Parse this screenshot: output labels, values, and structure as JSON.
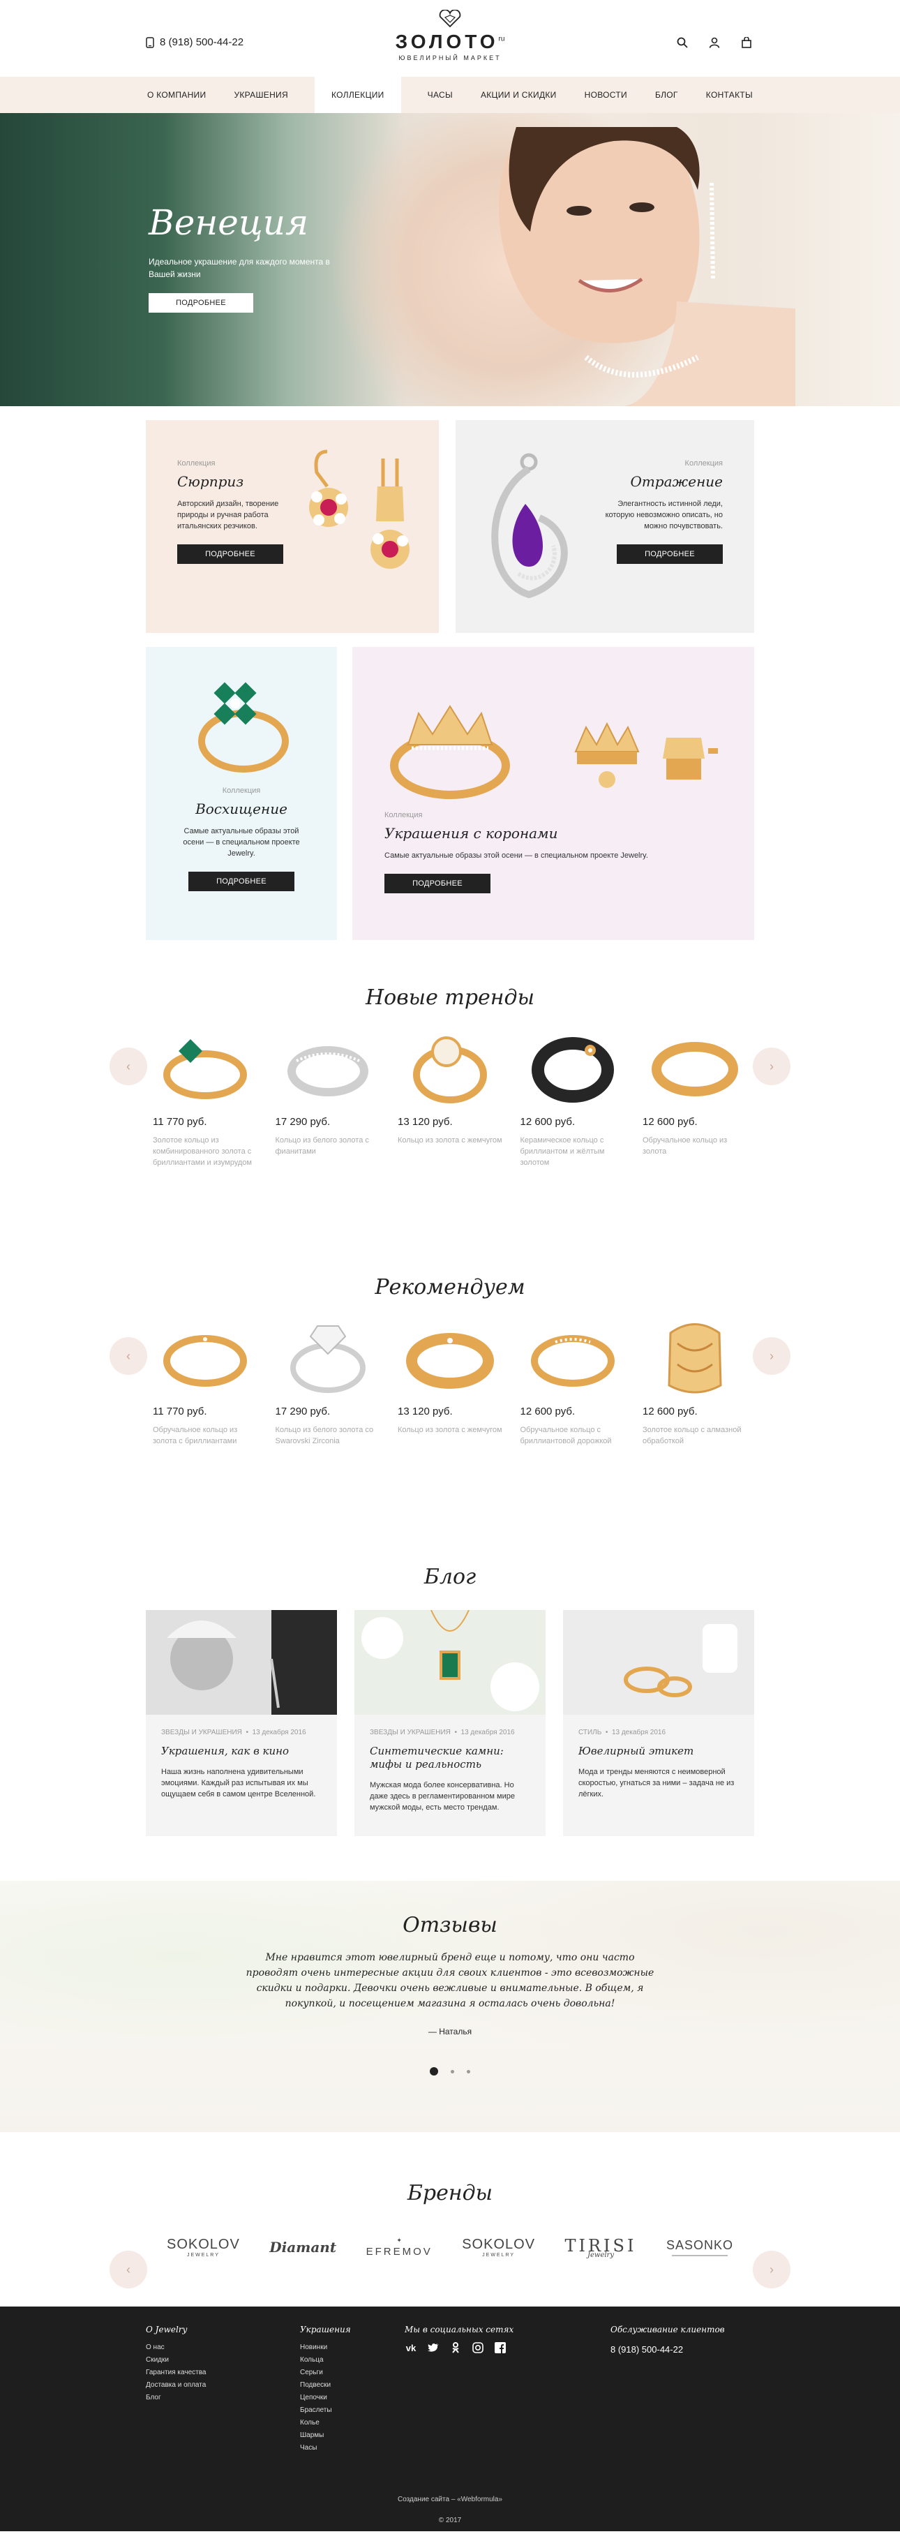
{
  "header": {
    "phone": "8 (918) 500-44-22",
    "logo_name": "ЗОЛОТО",
    "logo_suffix": "ru",
    "logo_sub": "ЮВЕЛИРНЫЙ МАРКЕТ"
  },
  "nav": [
    "О компании",
    "Украшения",
    "Коллекции",
    "Часы",
    "Акции и скидки",
    "Новости",
    "Блог",
    "Контакты"
  ],
  "hero": {
    "title": "Венеция",
    "text": "Идеальное украшение для каждого момента в Вашей жизни",
    "button": "Подробнее"
  },
  "collections": [
    {
      "label": "Коллекция",
      "title": "Сюрприз",
      "text": "Авторский дизайн, творение природы и ручная работа итальянских резчиков.",
      "button": "Подробнее"
    },
    {
      "label": "Коллекция",
      "title": "Отражение",
      "text": "Элегантность истинной леди, которую невозможно описать, но можно почувствовать.",
      "button": "Подробнее"
    },
    {
      "label": "Коллекция",
      "title": "Восхищение",
      "text": "Самые актуальные образы этой осени — в специальном проекте Jewelry.",
      "button": "Подробнее"
    },
    {
      "label": "Коллекция",
      "title": "Украшения с коронами",
      "text": "Самые актуальные образы этой осени — в специальном проекте Jewelry.",
      "button": "Подробнее"
    }
  ],
  "trends": {
    "title": "Новые тренды",
    "items": [
      {
        "price": "11 770 руб.",
        "desc": "Золотое кольцо из комбинированного золота с бриллиантами и изумрудом"
      },
      {
        "price": "17 290 руб.",
        "desc": "Кольцо из белого золота с фианитами"
      },
      {
        "price": "13 120 руб.",
        "desc": "Кольцо из золота с жемчугом"
      },
      {
        "price": "12 600 руб.",
        "desc": "Керамическое кольцо с бриллиантом и жёлтым золотом"
      },
      {
        "price": "12 600 руб.",
        "desc": "Обручальное кольцо из золота"
      }
    ]
  },
  "recommend": {
    "title": "Рекомендуем",
    "items": [
      {
        "price": "11 770 руб.",
        "desc": "Обручальное кольцо из золота с бриллиантами"
      },
      {
        "price": "17 290 руб.",
        "desc": "Кольцо из белого золота со Swarovski Zirconia"
      },
      {
        "price": "13 120 руб.",
        "desc": "Кольцо из золота с жемчугом"
      },
      {
        "price": "12 600 руб.",
        "desc": "Обручальное кольцо с бриллиантовой дорожкой"
      },
      {
        "price": "12 600 руб.",
        "desc": "Золотое кольцо с алмазной обработкой"
      }
    ]
  },
  "blog": {
    "title": "Блог",
    "posts": [
      {
        "tag": "Звезды и украшения",
        "date": "13 декабря 2016",
        "title": "Украшения, как в кино",
        "text": "Наша жизнь наполнена удивительными эмоциями. Каждый раз испытывая их мы ощущаем себя в самом центре Вселенной."
      },
      {
        "tag": "Звезды и украшения",
        "date": "13 декабря 2016",
        "title": "Синтетические камни: мифы и реальность",
        "text": "Мужская мода более консервативна. Но даже здесь в регламентированном мире мужской моды, есть место трендам."
      },
      {
        "tag": "Стиль",
        "date": "13 декабря 2016",
        "title": "Ювелирный этикет",
        "text": "Мода и тренды меняются с неимоверной скоростью, угнаться за ними – задача не из лёгких."
      }
    ]
  },
  "reviews": {
    "title": "Отзывы",
    "quote": "Мне нравится этот ювелирный бренд еще и потому, что они часто проводят очень интересные акции для своих клиентов - это всевозможные скидки и подарки. Девочки очень вежливые и внимательные. В общем, я покупкой, и посещением магазина я осталась очень довольна!",
    "author": "— Наталья"
  },
  "brands": {
    "title": "Бренды",
    "items": [
      {
        "name": "SOKOLOV",
        "sub": "JEWELRY"
      },
      {
        "name": "Diamant",
        "sub": ""
      },
      {
        "name": "EFREMOV",
        "sub": ""
      },
      {
        "name": "SOKOLOV",
        "sub": "JEWELRY"
      },
      {
        "name": "TIRISI",
        "sub": "Jewelry"
      },
      {
        "name": "SASONKO",
        "sub": ""
      }
    ]
  },
  "footer": {
    "about_title": "О Jewelry",
    "about_links": [
      "О нас",
      "Скидки",
      "Гарантия качества",
      "Доставка и оплата",
      "Блог"
    ],
    "jewelry_title": "Украшения",
    "jewelry_links": [
      "Новинки",
      "Кольца",
      "Серьги",
      "Подвески",
      "Цепочки",
      "Браслеты",
      "Колье",
      "Шармы",
      "Часы"
    ],
    "social_title": "Мы в социальных сетях",
    "social": [
      "vk-icon",
      "twitter-icon",
      "odnoklassniki-icon",
      "instagram-icon",
      "facebook-icon"
    ],
    "service_title": "Обслуживание клиентов",
    "service_phone": "8 (918) 500-44-22",
    "credit": "Создание сайта – «Webformula»",
    "copyright": "© 2017"
  },
  "colors": {
    "dark": "#222222",
    "nav_bg": "#f7eee8",
    "gold": "#e3a752",
    "footer_bg": "#1e1e1e"
  }
}
